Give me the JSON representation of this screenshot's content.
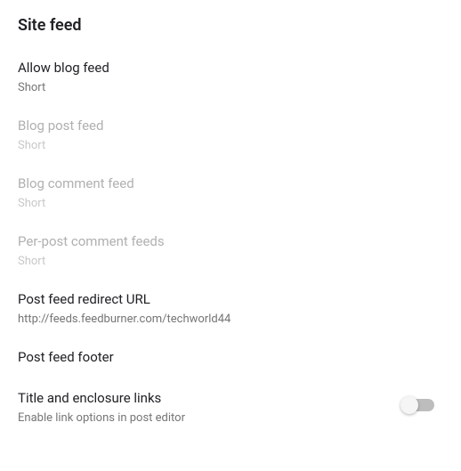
{
  "section_title": "Site feed",
  "settings": {
    "allow_blog_feed": {
      "label": "Allow blog feed",
      "value": "Short"
    },
    "blog_post_feed": {
      "label": "Blog post feed",
      "value": "Short"
    },
    "blog_comment_feed": {
      "label": "Blog comment feed",
      "value": "Short"
    },
    "per_post_comment_feeds": {
      "label": "Per-post comment feeds",
      "value": "Short"
    },
    "post_feed_redirect": {
      "label": "Post feed redirect URL",
      "value": "http://feeds.feedburner.com/techworld44"
    },
    "post_feed_footer": {
      "label": "Post feed footer"
    },
    "title_enclosure": {
      "label": "Title and enclosure links",
      "description": "Enable link options in post editor",
      "enabled": false
    }
  }
}
